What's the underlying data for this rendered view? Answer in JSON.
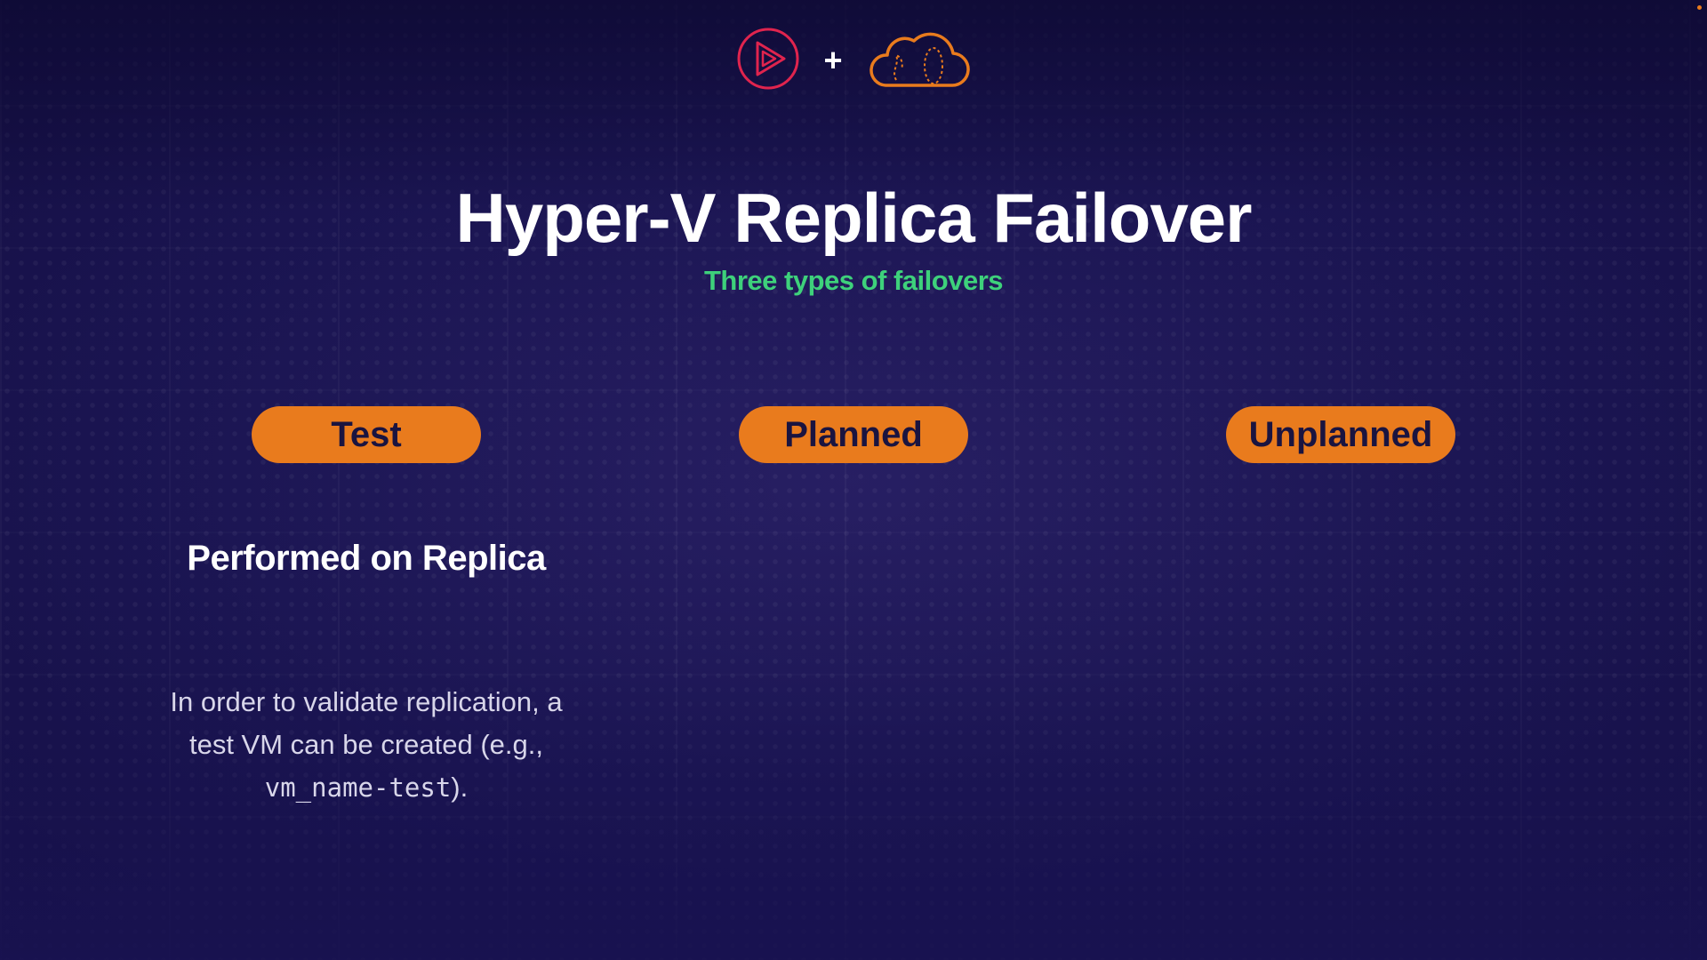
{
  "header": {
    "logo_left_icon": "play-logo-icon",
    "plus": "+",
    "logo_right_icon": "cloud-logo-icon"
  },
  "slide": {
    "title": "Hyper-V Replica Failover",
    "subtitle": "Three types of failovers",
    "types": [
      "Test",
      "Planned",
      "Unplanned"
    ],
    "performed_heading": "Performed on Replica",
    "description_part1": "In order to validate replication, a test VM can be created (e.g., ",
    "description_code": "vm_name-test",
    "description_part2": ")."
  },
  "colors": {
    "accent_orange": "#e97b1d",
    "accent_green": "#3ed17b",
    "logo_red": "#e0244e",
    "background": "#1c1655"
  }
}
